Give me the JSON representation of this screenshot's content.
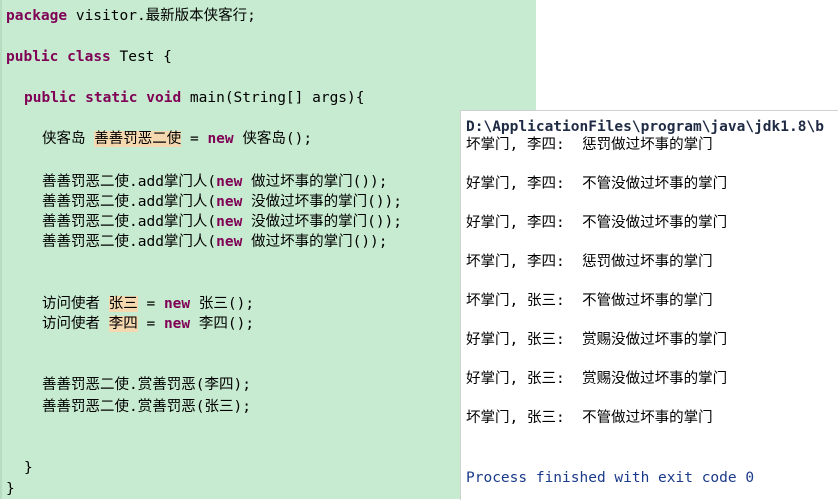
{
  "code": {
    "package_kw": "package",
    "package_name": "visitor.最新版本侠客行;",
    "public1": "public",
    "class_kw": "class",
    "class_name": "Test {",
    "public2": "public",
    "static_kw": "static",
    "void_kw": "void",
    "main_sig": "main(String[] args){",
    "l1_type": "侠客岛",
    "l1_var": "善善罚恶二使",
    "l1_eq": " = ",
    "l1_new": "new",
    "l1_rest": " 侠客岛();",
    "add1_prefix": "善善罚恶二使.add掌门人(",
    "add1_new": "new",
    "add1_rest": " 做过坏事的掌门());",
    "add2_prefix": "善善罚恶二使.add掌门人(",
    "add2_new": "new",
    "add2_rest": " 没做过坏事的掌门());",
    "add3_prefix": "善善罚恶二使.add掌门人(",
    "add3_new": "new",
    "add3_rest": " 没做过坏事的掌门());",
    "add4_prefix": "善善罚恶二使.add掌门人(",
    "add4_new": "new",
    "add4_rest": " 做过坏事的掌门());",
    "v1_type": "访问使者",
    "v1_var": "张三",
    "v1_eq": " = ",
    "v1_new": "new",
    "v1_rest": " 张三();",
    "v2_type": "访问使者",
    "v2_var": "李四",
    "v2_eq": " = ",
    "v2_new": "new",
    "v2_rest": " 李四();",
    "call1": "善善罚恶二使.赏善罚恶(李四);",
    "call2": "善善罚恶二使.赏善罚恶(张三);",
    "close1": "}",
    "close2": "}"
  },
  "console": {
    "path": "D:\\ApplicationFiles\\program\\java\\jdk1.8\\b",
    "lines": [
      "坏掌门, 李四:  惩罚做过坏事的掌门",
      "好掌门, 李四:  不管没做过坏事的掌门",
      "好掌门, 李四:  不管没做过坏事的掌门",
      "坏掌门, 李四:  惩罚做过坏事的掌门",
      "坏掌门, 张三:  不管做过坏事的掌门",
      "好掌门, 张三:  赏赐没做过坏事的掌门",
      "好掌门, 张三:  赏赐没做过坏事的掌门",
      "坏掌门, 张三:  不管做过坏事的掌门"
    ],
    "finished": "Process finished with exit code 0"
  }
}
